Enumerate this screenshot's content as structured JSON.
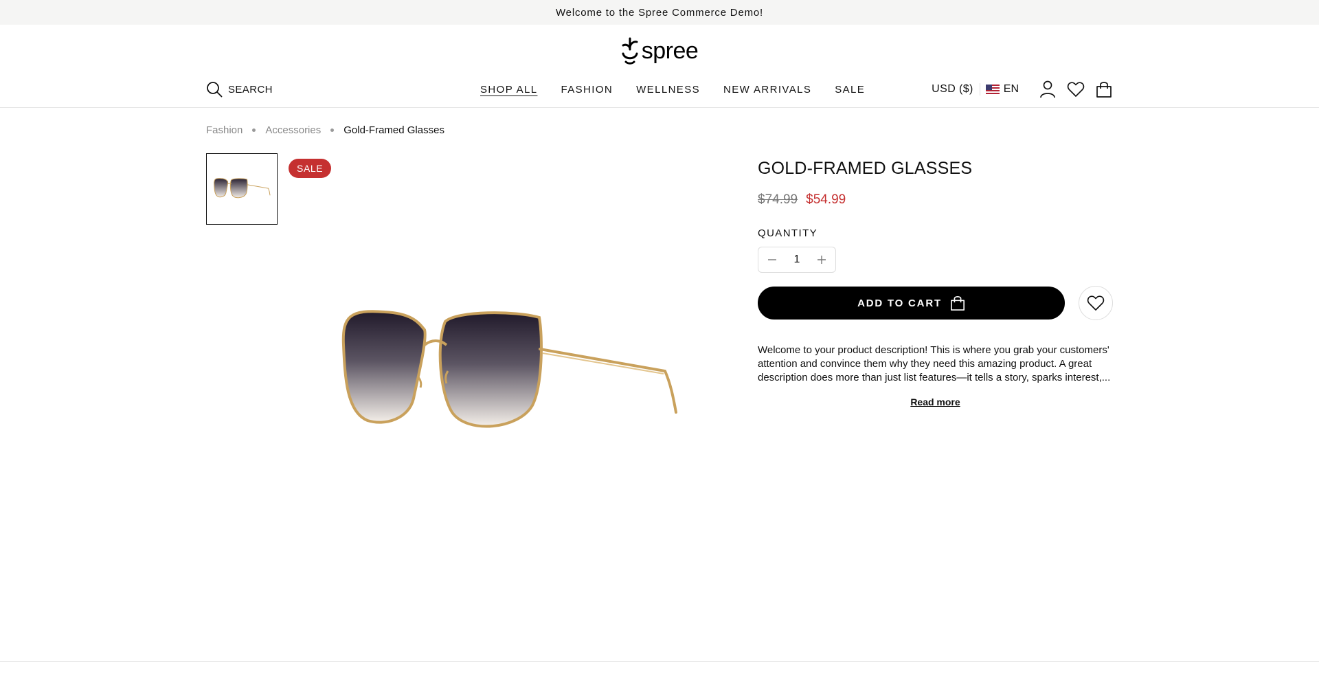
{
  "announcement": "Welcome to the Spree Commerce Demo!",
  "logo": {
    "text": "spree"
  },
  "header": {
    "search_label": "SEARCH",
    "nav": [
      {
        "label": "SHOP ALL",
        "active": true
      },
      {
        "label": "FASHION"
      },
      {
        "label": "WELLNESS"
      },
      {
        "label": "NEW ARRIVALS"
      },
      {
        "label": "SALE"
      }
    ],
    "currency": "USD ($)",
    "language": "EN"
  },
  "breadcrumb": [
    "Fashion",
    "Accessories",
    "Gold-Framed Glasses"
  ],
  "product": {
    "badge": "SALE",
    "title": "GOLD-FRAMED GLASSES",
    "old_price": "$74.99",
    "price": "$54.99",
    "quantity_label": "QUANTITY",
    "quantity": "1",
    "add_to_cart": "ADD TO CART",
    "description": "Welcome to your product description! This is where you grab your customers' attention and convince them why they need this amazing product. A great description does more than just list features—it tells a story, sparks interest,...",
    "read_more": "Read more"
  },
  "colors": {
    "sale": "#c53030",
    "topbar_bg": "#f5f5f4",
    "button": "#000000"
  }
}
